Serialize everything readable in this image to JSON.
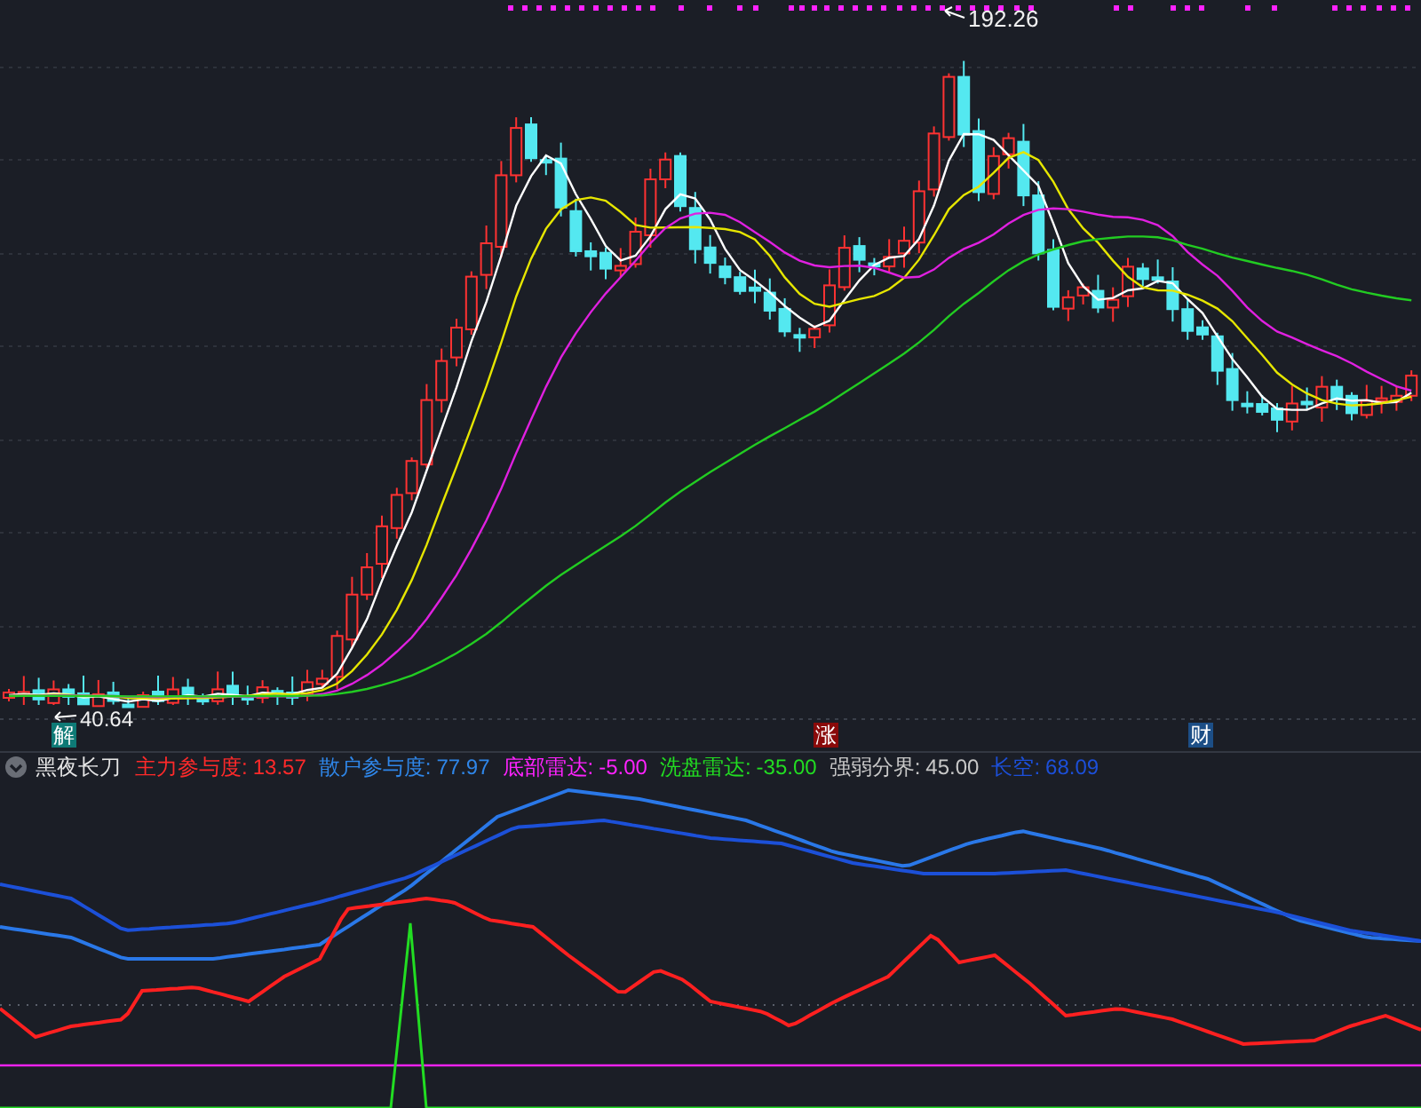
{
  "price_chart": {
    "high_label": "192.26",
    "low_label": "40.64",
    "markers": [
      {
        "text": "解",
        "color": "#0e7a76"
      },
      {
        "text": "涨",
        "color": "#8a0a0a"
      },
      {
        "text": "财",
        "color": "#1c4e86"
      }
    ]
  },
  "indicator": {
    "name": "黑夜长刀",
    "values": [
      {
        "label": "主力参与度:",
        "value": "13.57",
        "color": "#ff2a2a"
      },
      {
        "label": "散户参与度:",
        "value": "77.97",
        "color": "#2f86e8"
      },
      {
        "label": "底部雷达:",
        "value": "-5.00",
        "color": "#ff22ff"
      },
      {
        "label": "洗盘雷达:",
        "value": "-35.00",
        "color": "#22dd22"
      },
      {
        "label": "强弱分界:",
        "value": "45.00",
        "color": "#c8c8c8"
      },
      {
        "label": "长空:",
        "value": "68.09",
        "color": "#1c4fd8"
      }
    ]
  }
}
